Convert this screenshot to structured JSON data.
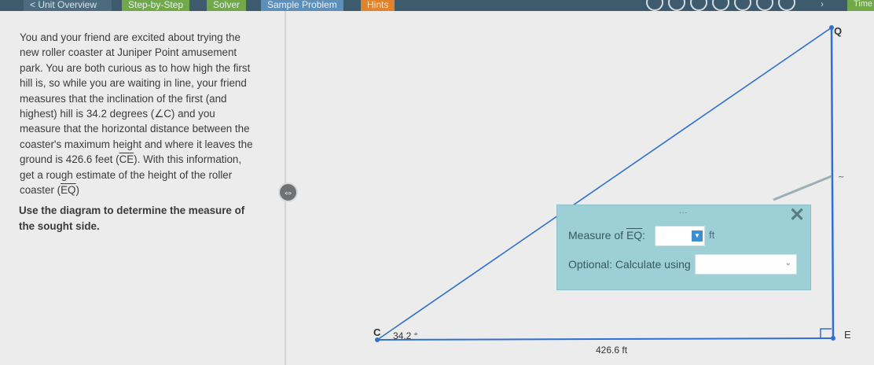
{
  "nav": {
    "back_label": "< Unit Overview",
    "tabs": [
      "Step-by-Step",
      "Solver",
      "Sample Problem",
      "Hints"
    ],
    "time_label": "Time"
  },
  "problem": {
    "l1": "You and your friend are excited about trying the",
    "l2": "new roller coaster at Juniper Point amusement",
    "l3": "park. You are both curious as to how high the first",
    "l4": "hill is, so while you are waiting in line, your friend",
    "l5": "measures that the inclination of the first (and",
    "l6a": "highest) hill is 34.2 degrees (",
    "angle_c": "∠C",
    "l6b": ") and you",
    "l7": "measure that the horizontal distance between the",
    "l8": "coaster's maximum height and where it leaves the",
    "l9a": "ground is 426.6 feet (",
    "seg_ce": "CE",
    "l9b": "). With this information,",
    "l10": "get a rough estimate of the height of the roller",
    "l11a": "coaster (",
    "seg_eq": "EQ",
    "l11b": ")",
    "instruction_1": "Use the diagram to determine the measure of",
    "instruction_2": "the sought side."
  },
  "diagram": {
    "label_c": "C",
    "label_q": "Q",
    "label_e": "E",
    "angle_label": "34.2 °",
    "base_label": "426.6 ft",
    "line_color": "#2f6fd1"
  },
  "modal": {
    "dots": "...",
    "close": "✕",
    "measure_prefix": "Measure of ",
    "measure_seg": "EQ",
    "measure_suffix": ":",
    "unit": "ft",
    "optional_label": "Optional: Calculate using",
    "answer_value": "",
    "select_value": ""
  }
}
